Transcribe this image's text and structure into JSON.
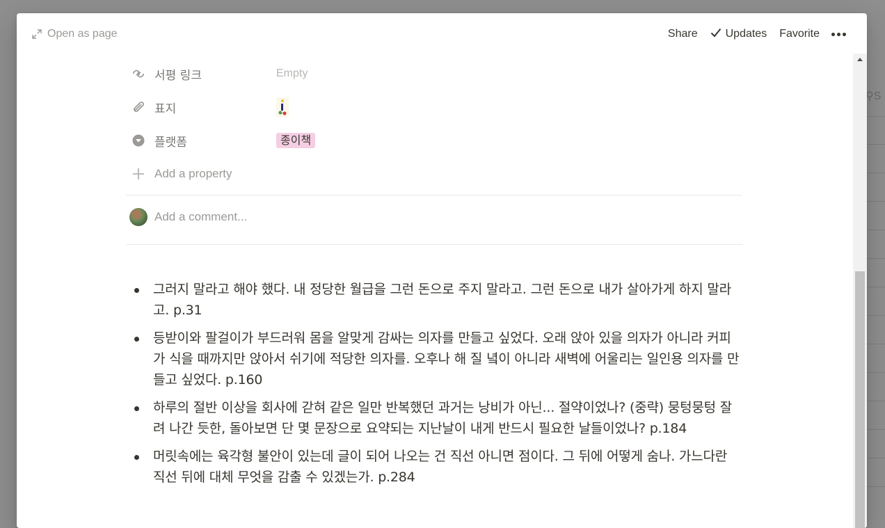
{
  "topbar": {
    "open_as_page": "Open as page",
    "share": "Share",
    "updates": "Updates",
    "favorite": "Favorite"
  },
  "properties": [
    {
      "icon": "review-link-icon",
      "name": "서평 링크",
      "value": "Empty"
    },
    {
      "icon": "paperclip-icon",
      "name": "표지",
      "value": ""
    },
    {
      "icon": "select-icon",
      "name": "플랫폼",
      "value": "종이책"
    }
  ],
  "add_property": "Add a property",
  "comment_placeholder": "Add a comment...",
  "bullets": [
    "그러지 말라고 해야 했다. 내 정당한 월급을 그런 돈으로 주지 말라고. 그런 돈으로 내가 살아가게 하지 말라고. p.31",
    "등받이와 팔걸이가 부드러워 몸을 알맞게 감싸는 의자를 만들고 싶었다. 오래 앉아 있을 의자가 아니라 커피가 식을 때까지만 앉아서 쉬기에 적당한 의자를. 오후나 해 질 녘이 아니라 새벽에 어울리는 일인용 의자를 만들고 싶었다. p.160",
    "하루의 절반 이상을 회사에 갇혀 같은 일만 반복했던 과거는 낭비가 아닌... 절약이었나? (중략) 뭉텅뭉텅 잘려 나간 듯한, 돌아보면 단 몇 문장으로 요약되는 지난날이 내게 반드시 필요한 날들이었나? p.184",
    "머릿속에는 육각형 불안이 있는데 글이 되어 나오는 건 직선 아니면 점이다. 그 뒤에 어떻게 숨나. 가느다란 직선 뒤에 대체 무엇을 감출 수 있겠는가. p.284"
  ],
  "background": {
    "search_fragment": "S"
  },
  "colors": {
    "tag_pink": "#f5cee4",
    "overlay": "#8f8f8f"
  }
}
